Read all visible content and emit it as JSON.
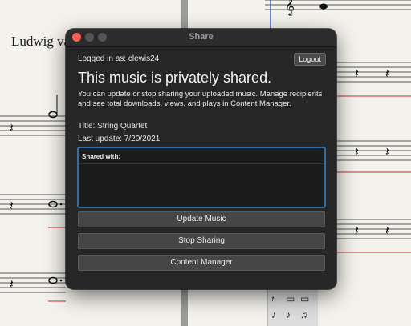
{
  "background": {
    "composer_text": "Ludwig va"
  },
  "window": {
    "title": "Share",
    "logged_in_label": "Logged in as:",
    "username": "clewis24",
    "logout_label": "Logout",
    "headline": "This music is privately shared.",
    "description": "You can update or stop sharing your uploaded music. Manage recipients and see total downloads, views, and plays in Content Manager.",
    "title_line": "Title: String Quartet",
    "last_update_line": "Last update: 7/20/2021",
    "shared_with_label": "Shared with:",
    "buttons": {
      "update": "Update Music",
      "stop": "Stop Sharing",
      "content_manager": "Content Manager"
    }
  },
  "colors": {
    "window_bg": "#262626",
    "focus_ring": "#2f6da3",
    "close_light": "#ff5f57"
  },
  "icons": [
    "close-light",
    "minimize-light",
    "maximize-light",
    "treble-clef-icon",
    "note-palette-icons"
  ]
}
